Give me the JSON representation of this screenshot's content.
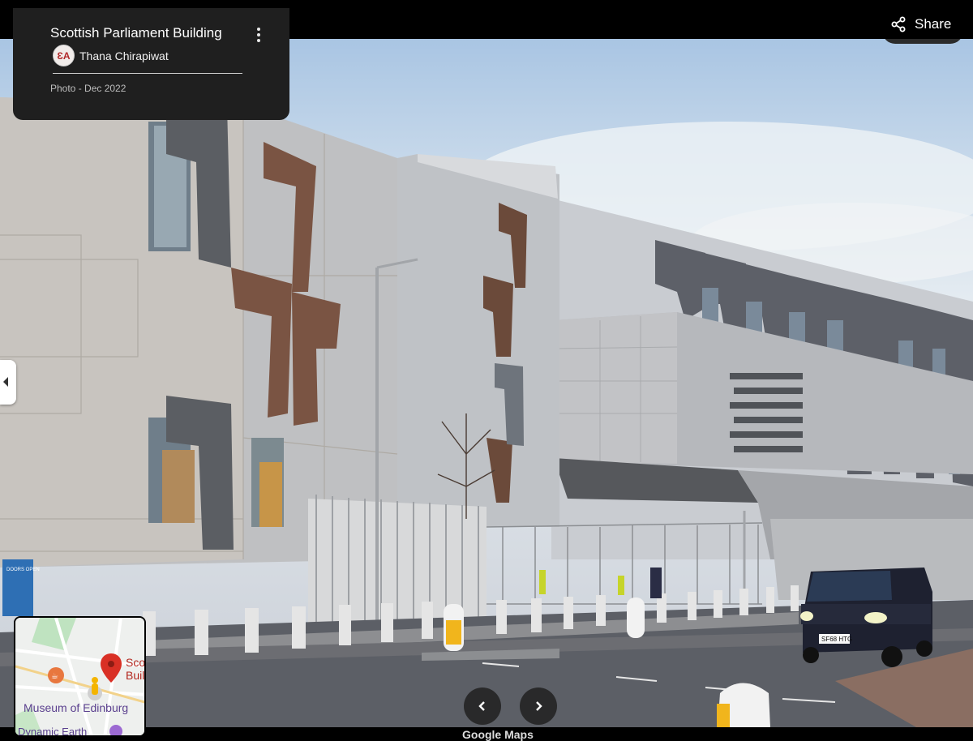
{
  "place": {
    "title": "Scottish Parliament Building",
    "author": "Thana Chirapiwat",
    "avatar_initials": "ƐA",
    "photo_date": "Photo - Dec 2022"
  },
  "share": {
    "label": "Share"
  },
  "navigation": {
    "prev_icon": "chevron-left-icon",
    "next_icon": "chevron-right-icon"
  },
  "minimap": {
    "place_label": "Sco\nBuil",
    "museum_label": "Museum of Edinburg",
    "poi_label": "Dynamic Earth"
  },
  "scene": {
    "door_sign": "DOORS OPEN",
    "taxi_plate": "SF68 HTG"
  },
  "footer": {
    "watermark": "Google Maps"
  },
  "colors": {
    "panel": "#1f1f1f",
    "pin": "#d93025",
    "pegman": "#f4b400"
  }
}
